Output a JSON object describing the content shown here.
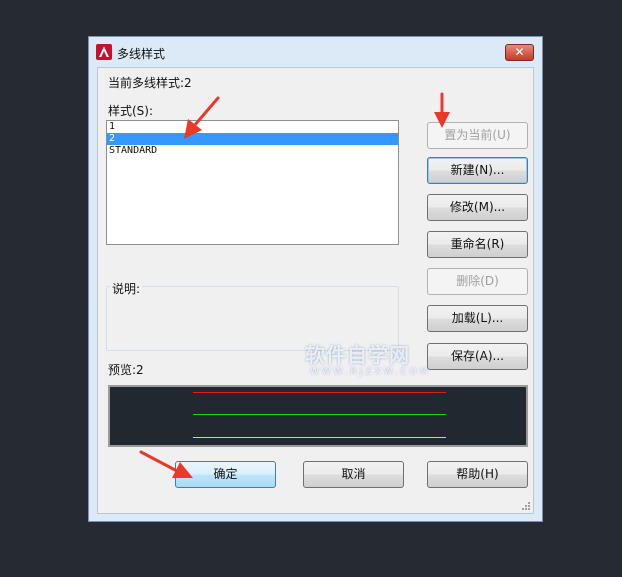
{
  "window": {
    "title": "多线样式",
    "close_glyph": "✕"
  },
  "current_style": {
    "label": "当前多线样式:",
    "value": "2"
  },
  "styles": {
    "label": "样式(S):",
    "items": [
      "1",
      "2",
      "STANDARD"
    ],
    "selected": "2"
  },
  "description": {
    "label": "说明:",
    "text": ""
  },
  "preview": {
    "label": "预览:",
    "value": "2",
    "line_colors": [
      "#e01b1b",
      "#19d419",
      "#e6e01a"
    ],
    "background": "#212830"
  },
  "buttons": {
    "set_current": "置为当前(U)",
    "new": "新建(N)...",
    "modify": "修改(M)...",
    "rename": "重命名(R)",
    "delete": "删除(D)",
    "load": "加载(L)...",
    "save": "保存(A)...",
    "ok": "确定",
    "cancel": "取消",
    "help": "帮助(H)"
  },
  "watermark": {
    "text": "软件自学网",
    "sub": "WWW.RJZXW.COM"
  },
  "colors": {
    "annotation_arrow": "#e8392b",
    "selection": "#3399ff",
    "logo_red": "#c8102e"
  },
  "icons": {
    "app": "autocad-logo-icon",
    "close": "close-icon",
    "resize": "resize-grip-icon"
  }
}
